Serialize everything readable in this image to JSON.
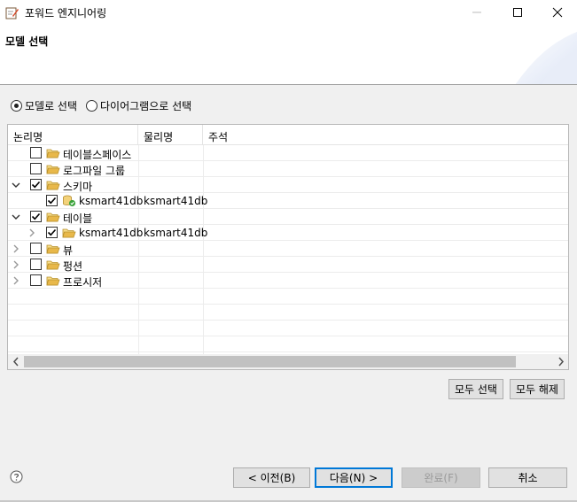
{
  "window": {
    "title": "포워드 엔지니어링"
  },
  "header": {
    "title": "모델 선택"
  },
  "selection_mode": {
    "options": [
      {
        "label": "모델로 선택",
        "selected": true
      },
      {
        "label": "다이어그램으로 선택",
        "selected": false
      }
    ]
  },
  "tree": {
    "columns": [
      "논리명",
      "물리명",
      "주석"
    ],
    "rows": [
      {
        "label": "테이블스페이스",
        "physical": "",
        "checked": false,
        "expand": "none",
        "icon": "folder-icon"
      },
      {
        "label": "로그파일 그룹",
        "physical": "",
        "checked": false,
        "expand": "none",
        "icon": "folder-icon"
      },
      {
        "label": "스키마",
        "physical": "",
        "checked": true,
        "expand": "expanded",
        "icon": "folder-icon"
      },
      {
        "label": "ksmart41db",
        "physical": "ksmart41db",
        "checked": true,
        "expand": "none",
        "icon": "schema-icon"
      },
      {
        "label": "테이블",
        "physical": "",
        "checked": true,
        "expand": "expanded",
        "icon": "folder-icon"
      },
      {
        "label": "ksmart41db",
        "physical": "ksmart41db",
        "checked": true,
        "expand": "collapsed",
        "icon": "folder-icon"
      },
      {
        "label": "뷰",
        "physical": "",
        "checked": false,
        "expand": "collapsed",
        "icon": "folder-icon"
      },
      {
        "label": "펑션",
        "physical": "",
        "checked": false,
        "expand": "collapsed",
        "icon": "folder-icon"
      },
      {
        "label": "프로시저",
        "physical": "",
        "checked": false,
        "expand": "collapsed",
        "icon": "folder-icon"
      }
    ]
  },
  "actions": {
    "select_all": "모두 선택",
    "deselect_all": "모두 해제"
  },
  "footer": {
    "back": "< 이전(B)",
    "next": "다음(N) >",
    "finish": "완료(F)",
    "cancel": "취소"
  },
  "colors": {
    "folder": "#e8b84a",
    "accent": "#0078d7",
    "schema_badge": "#3aa23a"
  }
}
